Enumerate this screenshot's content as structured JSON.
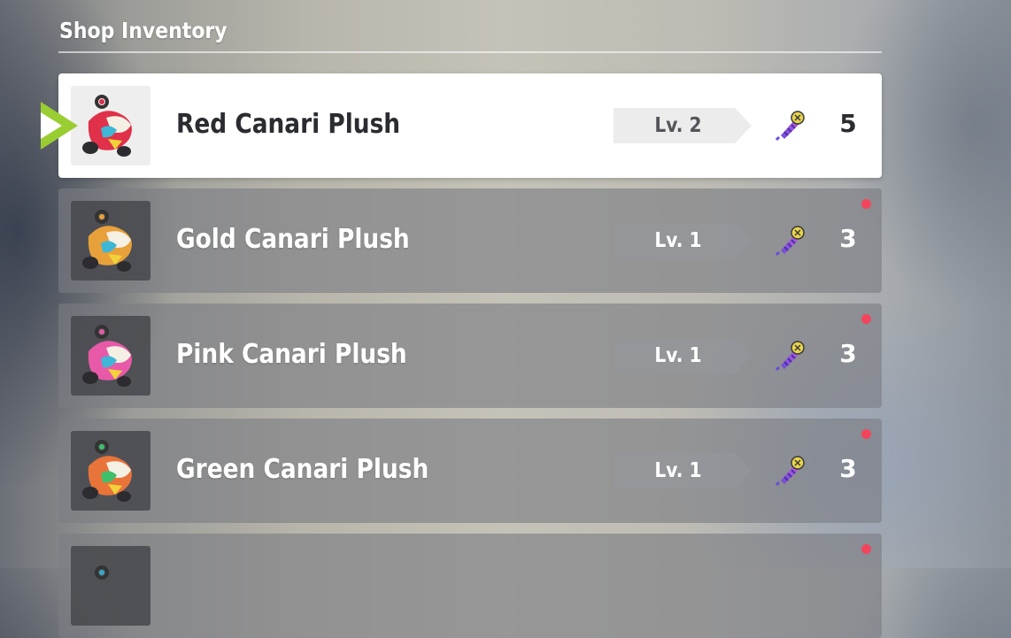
{
  "header": {
    "title": "Shop Inventory"
  },
  "colors": {
    "selected_background": "#ffffff",
    "cursor_green": "#9acd32",
    "notification_dot": "#f2455d",
    "bolt_gradient": [
      "#6b4bd8",
      "#c35fe0"
    ],
    "bolt_head": "#e8d44a"
  },
  "items": [
    {
      "name": "Red Canari Plush",
      "level": "Lv. 2",
      "cost": "5",
      "selected": true,
      "has_notification": false,
      "icon": "red-canari-plush-icon",
      "accent": "#e0304a"
    },
    {
      "name": "Gold Canari Plush",
      "level": "Lv. 1",
      "cost": "3",
      "selected": false,
      "has_notification": true,
      "icon": "gold-canari-plush-icon",
      "accent": "#e8a13a"
    },
    {
      "name": "Pink Canari Plush",
      "level": "Lv. 1",
      "cost": "3",
      "selected": false,
      "has_notification": true,
      "icon": "pink-canari-plush-icon",
      "accent": "#e85aa8"
    },
    {
      "name": "Green Canari Plush",
      "level": "Lv. 1",
      "cost": "3",
      "selected": false,
      "has_notification": true,
      "icon": "green-canari-plush-icon",
      "accent": "#3fbf6a"
    },
    {
      "name": "",
      "level": "",
      "cost": "",
      "selected": false,
      "has_notification": true,
      "icon": "plush-icon",
      "accent": "#3aa6c9"
    }
  ],
  "cost_icon": "bolt-currency-icon",
  "selection_cursor_icon": "selection-arrow-icon"
}
